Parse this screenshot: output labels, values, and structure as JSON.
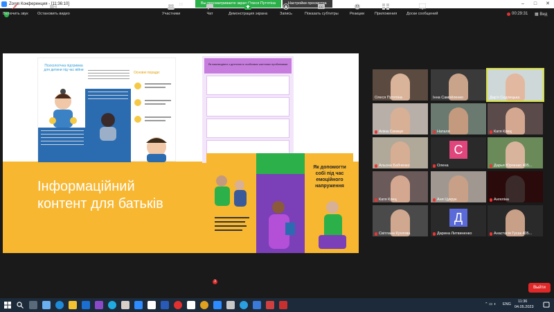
{
  "window": {
    "title": "Zoom Конференция - [11:36:10]"
  },
  "share_banner": {
    "viewing": "Вы просматриваете экран Олеся Путятіна",
    "options": "Настройки просмотра"
  },
  "meeting": {
    "timer": "00:29:31",
    "view_label": "Вид"
  },
  "slide": {
    "heading": "Інформаційний контент для батьків",
    "leaflet1_title": "Психологічна підтримка для дитини під час війни",
    "leaflet1_right_title": "Основні поради:",
    "leaflet2_title": "Як взаємодіяти з дитиною в особливих життєвих проблемами",
    "leaflet3_title": "Як допомогти собі під час емоційного напруження"
  },
  "participants": [
    {
      "name": "Олеся Путятіна",
      "skin": "#d9b49a",
      "bg": "#5a4a40"
    },
    {
      "name": "Інна Самойленко",
      "skin": "#c9a48a",
      "bg": "#3a3a3a"
    },
    {
      "name": "Дар'я Седлецька",
      "skin": "#e2b8a0",
      "bg": "#cfd8d8",
      "active": true
    },
    {
      "name": "Аліна Синиця",
      "skin": "#d8b096",
      "bg": "#b8b0a8",
      "muted": true
    },
    {
      "name": "Наталя",
      "skin": "#c49a7e",
      "bg": "#6a7a70",
      "muted": true
    },
    {
      "name": "Катя Клец",
      "skin": "#d4a890",
      "bg": "#5a4a4a",
      "muted": true
    },
    {
      "name": "Альона Бабченко",
      "skin": "#d6ae94",
      "bg": "#b0a898",
      "muted": true
    },
    {
      "name": "Олена",
      "letter": "С",
      "avatar": "#e0457b",
      "muted": true
    },
    {
      "name": "Дарья Юрченко 405...",
      "skin": "#d8b49c",
      "bg": "#6a8a5a",
      "muted": true
    },
    {
      "name": "Катя Клец",
      "skin": "#d4a890",
      "bg": "#6a5a5a",
      "muted": true
    },
    {
      "name": "Аня Цукрук",
      "skin": "#c8a088",
      "bg": "#a09890",
      "muted": true
    },
    {
      "name": "Ангеліна",
      "skin": "#3a2a2a",
      "bg": "#2a0a0a",
      "muted": true
    },
    {
      "name": "Світлана Кухлова",
      "skin": "#d0a890",
      "bg": "#4a4a4a",
      "muted": true
    },
    {
      "name": "Дарина Литвиненко",
      "letter": "Д",
      "avatar": "#5a6ad8",
      "muted": true
    },
    {
      "name": "Анастасія Гусак 405...",
      "skin": "#c8a088",
      "bg": "#2a2a2a",
      "muted": true
    }
  ],
  "toolbar": {
    "unmute": "Включить звук",
    "stop_video": "Остановить видео",
    "participants": "Участники",
    "participants_count": "15",
    "chat": "Чат",
    "chat_badge": "3",
    "share_screen": "Демонстрация экрана",
    "record": "Запись",
    "captions": "Показать субтитры",
    "reactions": "Реакции",
    "apps": "Приложения",
    "whiteboard": "Доски сообщений",
    "end": "Выйти"
  },
  "taskbar": {
    "lang": "ENG",
    "time": "11:36",
    "date": "04.05.2023"
  },
  "colors": {
    "accent_green": "#2bb04a",
    "end_red": "#e02828",
    "slide_yellow": "#f7b731",
    "active_outline": "#d7e03a"
  }
}
